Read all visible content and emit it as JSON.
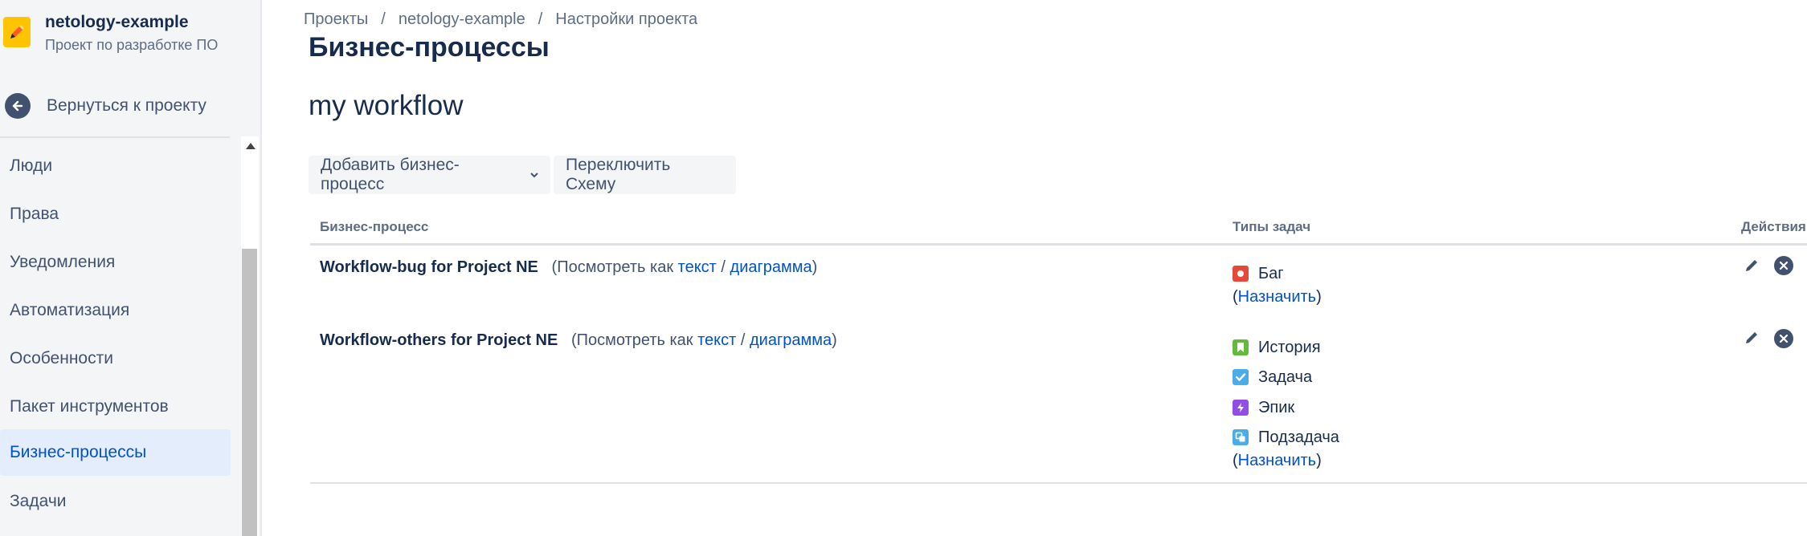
{
  "project": {
    "name": "netology-example",
    "type": "Проект по разработке ПО",
    "avatar_color": "#ffc400"
  },
  "sidebar": {
    "back_label": "Вернуться к проекту",
    "items": [
      {
        "label": "Люди"
      },
      {
        "label": "Права"
      },
      {
        "label": "Уведомления"
      },
      {
        "label": "Автоматизация"
      },
      {
        "label": "Особенности"
      },
      {
        "label": "Пакет инструментов"
      },
      {
        "label": "Бизнес-процессы",
        "active": true
      },
      {
        "label": "Задачи"
      }
    ]
  },
  "breadcrumb": {
    "items": [
      "Проекты",
      "netology-example",
      "Настройки проекта"
    ],
    "separator": "/"
  },
  "page": {
    "title": "Бизнес-процессы",
    "scheme_name": "my workflow"
  },
  "toolbar": {
    "add_label": "Добавить бизнес-процесс",
    "switch_label": "Переключить Схему"
  },
  "table": {
    "headers": {
      "workflow": "Бизнес-процесс",
      "issue_types": "Типы задач",
      "actions": "Действия"
    },
    "rows": [
      {
        "name": "Workflow-bug for Project NE",
        "view_prefix": "(Посмотреть как",
        "text_link": "текст",
        "slash": "/",
        "diagram_link": "диаграмма",
        "view_suffix": ")",
        "issue_types": [
          {
            "label": "Баг",
            "icon": "bug-icon",
            "color": "#e5493a"
          }
        ],
        "assign_open": "(",
        "assign_label": "Назначить",
        "assign_close": ")"
      },
      {
        "name": "Workflow-others for Project NE",
        "view_prefix": "(Посмотреть как",
        "text_link": "текст",
        "slash": "/",
        "diagram_link": "диаграмма",
        "view_suffix": ")",
        "issue_types": [
          {
            "label": "История",
            "icon": "story-icon",
            "color": "#63ba3c"
          },
          {
            "label": "Задача",
            "icon": "task-icon",
            "color": "#4bade8"
          },
          {
            "label": "Эпик",
            "icon": "epic-icon",
            "color": "#904ee2"
          },
          {
            "label": "Подзадача",
            "icon": "subtask-icon",
            "color": "#4bade8"
          }
        ],
        "assign_open": "(",
        "assign_label": "Назначить",
        "assign_close": ")"
      }
    ]
  }
}
